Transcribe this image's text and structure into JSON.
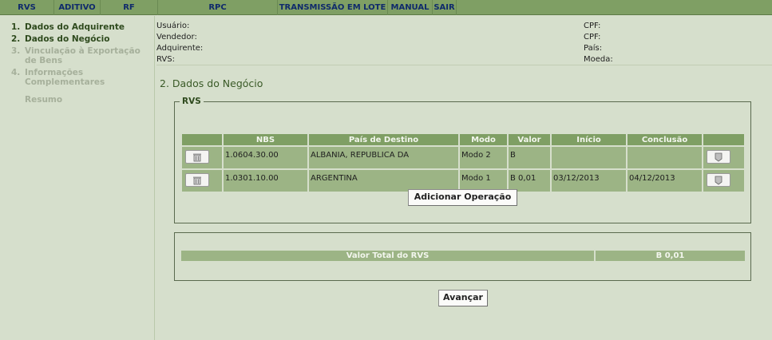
{
  "menu": [
    {
      "label": "RVS",
      "w": 68
    },
    {
      "label": "ADITIVO",
      "w": 58
    },
    {
      "label": "RF",
      "w": 72
    },
    {
      "label": "RPC",
      "w": 150
    },
    {
      "label": "TRANSMISSÃO EM LOTE",
      "w": 138
    },
    {
      "label": "MANUAL",
      "w": 56
    },
    {
      "label": "SAIR",
      "w": 30
    }
  ],
  "sidebar": {
    "steps": [
      {
        "num": "1.",
        "label": "Dados do Adquirente",
        "state": "active"
      },
      {
        "num": "2.",
        "label": "Dados do Negócio",
        "state": "active"
      },
      {
        "num": "3.",
        "label": "Vinculação à Exportação de Bens",
        "state": "inactive"
      },
      {
        "num": "4.",
        "label": "Informações Complementares",
        "state": "inactive"
      }
    ],
    "resumo": "Resumo"
  },
  "info": {
    "usuario": "Usuário:",
    "vendedor": "Vendedor:",
    "adquirente": "Adquirente:",
    "rvs": "RVS:",
    "cpf1": "CPF:",
    "cpf2": "CPF:",
    "pais": "País:",
    "moeda": "Moeda:"
  },
  "section_title": "2. Dados do Negócio",
  "rvs_legend": "RVS",
  "table": {
    "headers": [
      "",
      "NBS",
      "País de Destino",
      "Modo",
      "Valor",
      "Início",
      "Conclusão",
      ""
    ],
    "rows": [
      {
        "nbs": "1.0604.30.00",
        "pais": "ALBANIA, REPUBLICA DA",
        "modo": "Modo 2",
        "valor": "B",
        "inicio": "",
        "conclusao": ""
      },
      {
        "nbs": "1.0301.10.00",
        "pais": "ARGENTINA",
        "modo": "Modo 1",
        "valor": "B 0,01",
        "inicio": "03/12/2013",
        "conclusao": "04/12/2013"
      }
    ]
  },
  "add_button": "Adicionar Operação",
  "total": {
    "label": "Valor Total do RVS",
    "value": "B 0,01"
  },
  "next_button": "Avançar",
  "colors": {
    "menu_bg": "#7f9f64",
    "menu_text": "#0f2a6b",
    "page_bg": "#d6dfcc",
    "row_bg": "#9cb485"
  }
}
